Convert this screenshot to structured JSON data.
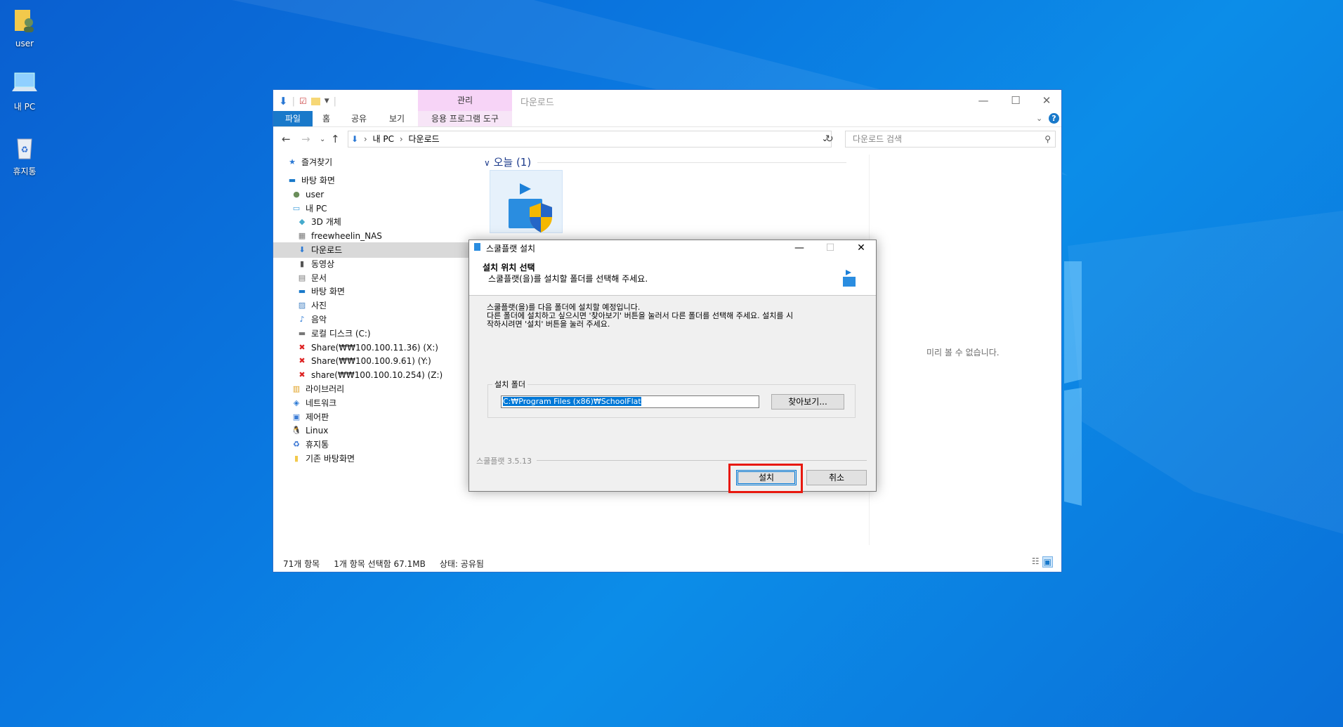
{
  "desktop": {
    "icons": [
      {
        "label": "user",
        "icon": "user-folder-icon"
      },
      {
        "label": "내 PC",
        "icon": "computer-icon"
      },
      {
        "label": "휴지통",
        "icon": "recycle-bin-icon"
      }
    ]
  },
  "explorer": {
    "title": "다운로드",
    "context_tab_header": "관리",
    "ribbon_tabs": [
      "파일",
      "홈",
      "공유",
      "보기",
      "응용 프로그램 도구"
    ],
    "address": {
      "segments": [
        "내 PC",
        "다운로드"
      ]
    },
    "search_placeholder": "다운로드 검색",
    "nav": {
      "items": [
        {
          "label": "즐겨찾기",
          "icon": "star-icon",
          "level": 0
        },
        {
          "label": "바탕 화면",
          "icon": "desktop-icon",
          "level": 0
        },
        {
          "label": "user",
          "icon": "user-icon",
          "level": 1
        },
        {
          "label": "내 PC",
          "icon": "computer-icon",
          "level": 1
        },
        {
          "label": "3D 개체",
          "icon": "cube-icon",
          "level": 2
        },
        {
          "label": "freewheelin_NAS",
          "icon": "network-drive-icon",
          "level": 2
        },
        {
          "label": "다운로드",
          "icon": "download-icon",
          "level": 2,
          "selected": true
        },
        {
          "label": "동영상",
          "icon": "video-icon",
          "level": 2
        },
        {
          "label": "문서",
          "icon": "document-icon",
          "level": 2
        },
        {
          "label": "바탕 화면",
          "icon": "desktop-icon",
          "level": 2
        },
        {
          "label": "사진",
          "icon": "picture-icon",
          "level": 2
        },
        {
          "label": "음악",
          "icon": "music-icon",
          "level": 2
        },
        {
          "label": "로컬 디스크 (C:)",
          "icon": "disk-icon",
          "level": 2
        },
        {
          "label": "Share(₩₩100.100.11.36) (X:)",
          "icon": "disconnected-drive-icon",
          "level": 2
        },
        {
          "label": "Share(₩₩100.100.9.61) (Y:)",
          "icon": "disconnected-drive-icon",
          "level": 2
        },
        {
          "label": "share(₩₩100.100.10.254) (Z:)",
          "icon": "disconnected-drive-icon",
          "level": 2
        },
        {
          "label": "라이브러리",
          "icon": "library-icon",
          "level": 1
        },
        {
          "label": "네트워크",
          "icon": "network-icon",
          "level": 1
        },
        {
          "label": "제어판",
          "icon": "control-panel-icon",
          "level": 1
        },
        {
          "label": "Linux",
          "icon": "linux-icon",
          "level": 1
        },
        {
          "label": "휴지통",
          "icon": "recycle-bin-icon",
          "level": 1
        },
        {
          "label": "기존 바탕화면",
          "icon": "folder-icon",
          "level": 1
        }
      ]
    },
    "content": {
      "group_header": "오늘 (1)"
    },
    "preview_text": "미리 볼 수 없습니다.",
    "status": {
      "items": "71개 항목",
      "selected": "1개 항목 선택함 67.1MB",
      "state": "상태: 공유됨"
    }
  },
  "dialog": {
    "title": "스쿨플랫 설치",
    "header_title": "설치 위치 선택",
    "header_subtitle": "스쿨플랫(을)를 설치할 폴더를 선택해 주세요.",
    "body_lines": [
      "스쿨플랫(을)를 다음 폴더에 설치할 예정입니다.",
      "다른 폴더에 설치하고 싶으시면 '찾아보기' 버튼을 눌러서 다른 폴더를 선택해 주세요. 설치를 시",
      "작하시려면 '설치' 버튼을 눌러 주세요."
    ],
    "folder_group_label": "설치 폴더",
    "folder_path": "C:₩Program Files (x86)₩SchoolFlat",
    "browse_label": "찾아보기...",
    "version": "스쿨플랫 3.5.13",
    "install_label": "설치",
    "cancel_label": "취소",
    "highlight_color": "#e8180e"
  }
}
